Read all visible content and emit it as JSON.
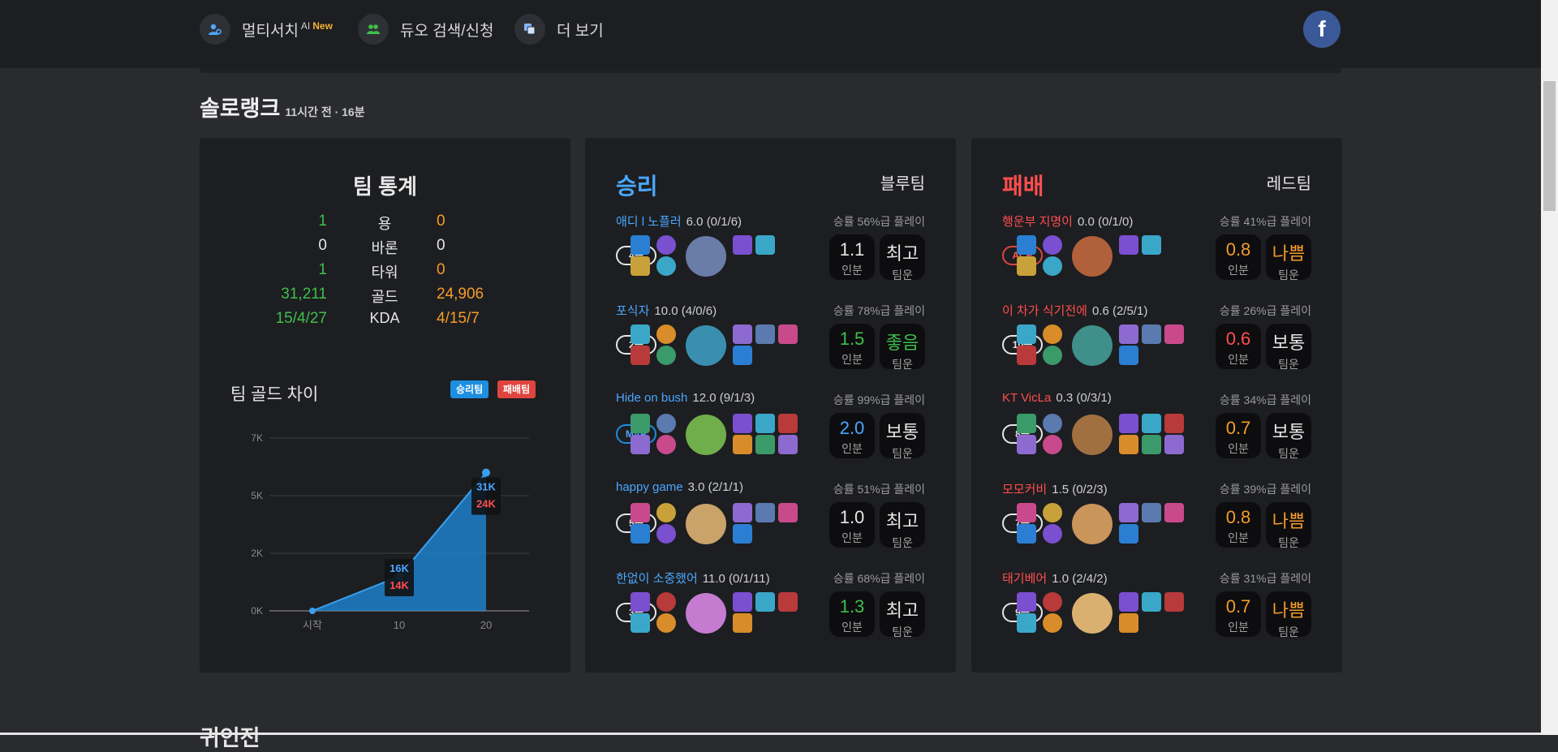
{
  "nav": {
    "multi_search": "멀티서치",
    "ai": "AI",
    "new": "New",
    "duo": "듀오 검색/신청",
    "more": "더 보기",
    "facebook": "f"
  },
  "section": {
    "title": "솔로랭크",
    "meta": "11시간 전 · 16분",
    "next_title": "귀인전"
  },
  "stats": {
    "title": "팀 통계",
    "rows": [
      {
        "left": "1",
        "label": "용",
        "right": "0"
      },
      {
        "left": "0",
        "label": "바론",
        "right": "0"
      },
      {
        "left": "1",
        "label": "타워",
        "right": "0"
      },
      {
        "left": "31,211",
        "label": "골드",
        "right": "24,906"
      },
      {
        "left": "15/4/27",
        "label": "KDA",
        "right": "4/15/7"
      }
    ],
    "gold_title": "팀 골드 차이",
    "legend_win": "승리팀",
    "legend_lose": "패배팀"
  },
  "chart_data": {
    "type": "area",
    "title": "팀 골드 차이",
    "x": [
      "시작",
      "10",
      "20"
    ],
    "series": [
      {
        "name": "승리팀",
        "values": [
          0,
          16,
          31
        ]
      },
      {
        "name": "패배팀",
        "values": [
          0,
          14,
          24
        ]
      }
    ],
    "y_ticks": [
      "0K",
      "2K",
      "5K",
      "7K"
    ],
    "ylim": [
      0,
      7
    ],
    "tooltips": [
      {
        "at": "10",
        "win": "16K",
        "lose": "14K"
      },
      {
        "at": "20",
        "win": "31K",
        "lose": "24K"
      }
    ],
    "grid": true,
    "colors": {
      "win": "#1d8ee0",
      "lose": "#e0443e"
    }
  },
  "teams": {
    "win": {
      "result": "승리",
      "side": "블루팀",
      "players": [
        {
          "name": "애디 l 노플러",
          "score": "6.0 (0/1/6)",
          "winrate": "승률 56%급 플레이",
          "badge": "4등",
          "val": "1.1",
          "val_label": "인분",
          "luck": "최고",
          "luck_label": "팀운"
        },
        {
          "name": "포식자",
          "score": "10.0 (4/0/6)",
          "winrate": "승률 78%급 플레이",
          "badge": "2등",
          "val": "1.5",
          "val_label": "인분",
          "luck": "좋음",
          "luck_label": "팀운"
        },
        {
          "name": "Hide on bush",
          "score": "12.0 (9/1/3)",
          "winrate": "승률 99%급 플레이",
          "badge": "MVP",
          "val": "2.0",
          "val_label": "인분",
          "luck": "보통",
          "luck_label": "팀운"
        },
        {
          "name": "happy game",
          "score": "3.0 (2/1/1)",
          "winrate": "승률 51%급 플레이",
          "badge": "5등",
          "val": "1.0",
          "val_label": "인분",
          "luck": "최고",
          "luck_label": "팀운"
        },
        {
          "name": "한없이 소중했어",
          "score": "11.0 (0/1/11)",
          "winrate": "승률 68%급 플레이",
          "badge": "3등",
          "val": "1.3",
          "val_label": "인분",
          "luck": "최고",
          "luck_label": "팀운"
        }
      ]
    },
    "lose": {
      "result": "패배",
      "side": "레드팀",
      "players": [
        {
          "name": "행운부 지명이",
          "score": "0.0 (0/1/0)",
          "winrate": "승률 41%급 플레이",
          "badge": "ACE",
          "val": "0.8",
          "val_label": "인분",
          "luck": "나쁨",
          "luck_label": "팀운"
        },
        {
          "name": "이 차가 식기전에",
          "score": "0.6 (2/5/1)",
          "winrate": "승률 26%급 플레이",
          "badge": "10등",
          "val": "0.6",
          "val_label": "인분",
          "luck": "보통",
          "luck_label": "팀운"
        },
        {
          "name": "KT VicLa",
          "score": "0.3 (0/3/1)",
          "winrate": "승률 34%급 플레이",
          "badge": "8등",
          "val": "0.7",
          "val_label": "인분",
          "luck": "보통",
          "luck_label": "팀운"
        },
        {
          "name": "모모커비",
          "score": "1.5 (0/2/3)",
          "winrate": "승률 39%급 플레이",
          "badge": "7등",
          "val": "0.8",
          "val_label": "인분",
          "luck": "나쁨",
          "luck_label": "팀운"
        },
        {
          "name": "태기베어",
          "score": "1.0 (2/4/2)",
          "winrate": "승률 31%급 플레이",
          "badge": "9등",
          "val": "0.7",
          "val_label": "인분",
          "luck": "나쁨",
          "luck_label": "팀운"
        }
      ]
    }
  }
}
